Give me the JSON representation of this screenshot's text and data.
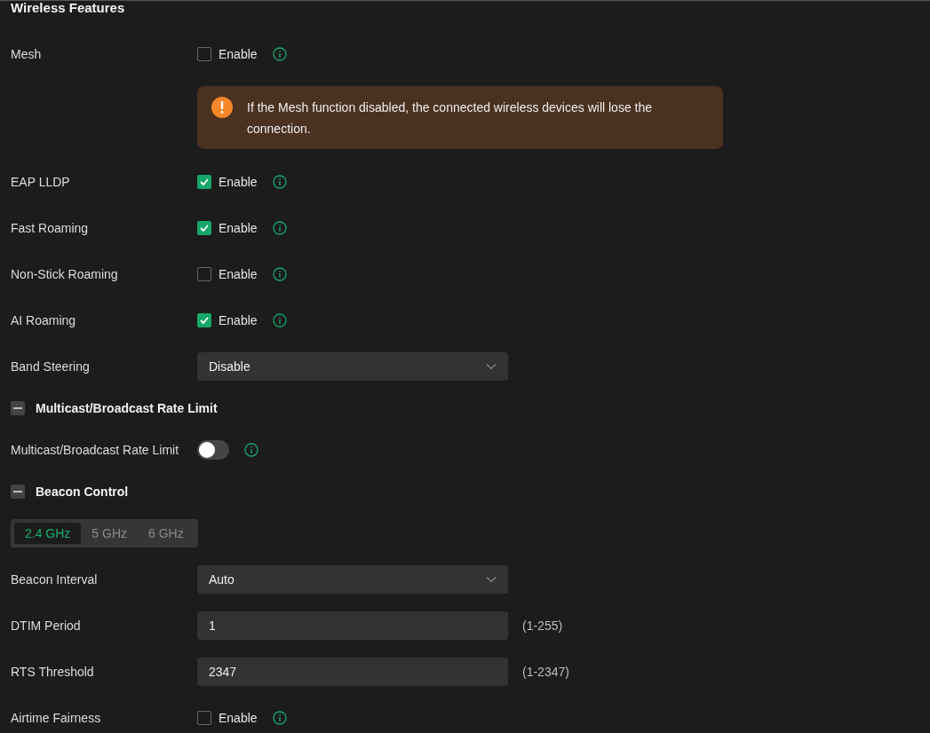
{
  "title": "Wireless Features",
  "rows": [
    {
      "kind": "checkbox",
      "label": "Mesh",
      "checked": false,
      "text": "Enable"
    },
    {
      "kind": "notice",
      "text": "If the Mesh function disabled, the connected wireless devices will lose the connection."
    },
    {
      "kind": "checkbox",
      "label": "EAP LLDP",
      "checked": true,
      "text": "Enable"
    },
    {
      "kind": "checkbox",
      "label": "Fast Roaming",
      "checked": true,
      "text": "Enable"
    },
    {
      "kind": "checkbox",
      "label": "Non-Stick Roaming",
      "checked": false,
      "text": "Enable"
    },
    {
      "kind": "checkbox",
      "label": "AI Roaming",
      "checked": true,
      "text": "Enable"
    },
    {
      "kind": "select",
      "label": "Band Steering",
      "value": "Disable"
    },
    {
      "kind": "section",
      "label": "Multicast/Broadcast Rate Limit",
      "expanded": true
    },
    {
      "kind": "toggle",
      "label": "Multicast/Broadcast Rate Limit",
      "on": false
    },
    {
      "kind": "section",
      "label": "Beacon Control",
      "expanded": true
    },
    {
      "kind": "tabs",
      "tabs": [
        {
          "label": "2.4 GHz",
          "selected": true
        },
        {
          "label": "5 GHz",
          "selected": false
        },
        {
          "label": "6 GHz",
          "selected": false
        }
      ]
    },
    {
      "kind": "select",
      "label": "Beacon Interval",
      "value": "Auto"
    },
    {
      "kind": "input",
      "label": "DTIM Period",
      "value": "1",
      "hint": "(1-255)"
    },
    {
      "kind": "input",
      "label": "RTS Threshold",
      "value": "2347",
      "hint": "(1-2347)"
    },
    {
      "kind": "checkbox",
      "label": "Airtime Fairness",
      "checked": false,
      "text": "Enable"
    }
  ]
}
